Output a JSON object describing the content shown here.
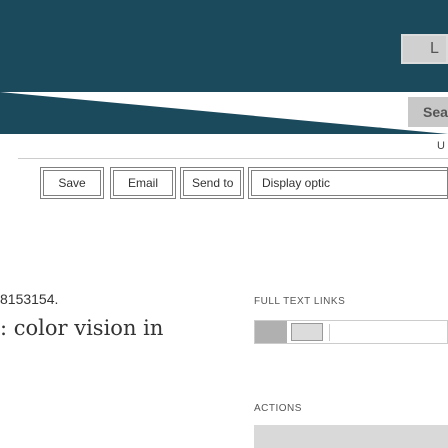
{
  "header": {
    "top_button_text": "L",
    "search_button_text": "Sea",
    "user_link_text": "U"
  },
  "toolbar": {
    "save_label": "Save",
    "email_label": "Email",
    "send_to_label": "Send to",
    "display_options_label": "Display optic"
  },
  "record": {
    "id_fragment": "8153154.",
    "title_fragment": ": color vision in"
  },
  "sidebar": {
    "full_text_links_label": "FULL TEXT LINKS",
    "full_text_link_1_text": "",
    "full_text_link_2_text": "",
    "actions_label": "ACTIONS"
  },
  "colors": {
    "header_background": "#1c4a5d",
    "button_grey": "#d0d0d0",
    "border": "#7f7f7f"
  }
}
